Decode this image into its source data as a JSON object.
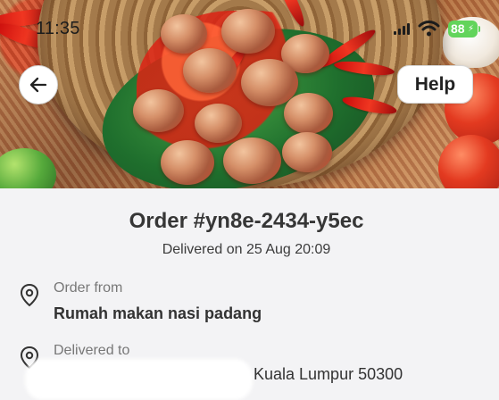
{
  "status_bar": {
    "time": "11:35",
    "battery": "88",
    "icons": [
      "signal-icon",
      "wifi-icon",
      "battery-icon"
    ]
  },
  "header": {
    "hero_image": "meatball-dish-photo",
    "back_icon": "arrow-left-icon",
    "help_label": "Help"
  },
  "order": {
    "title": "Order #yn8e-2434-y5ec",
    "delivered_on": "Delivered on 25 Aug 20:09",
    "order_from_label": "Order from",
    "restaurant": "Rumah makan nasi padang",
    "delivered_to_label": "Delivered to",
    "address_visible": "Kuala Lumpur 50300"
  },
  "colors": {
    "background": "#f3f3f5",
    "primary_text": "#333333",
    "muted_text": "#777777",
    "battery": "#62d45b"
  }
}
